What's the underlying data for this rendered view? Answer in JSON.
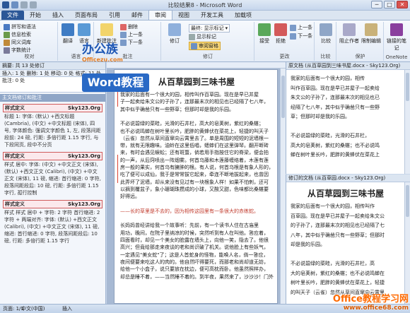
{
  "titlebar": {
    "title": "比较结果8 - Microsoft Word",
    "minimize": "─",
    "maximize": "□",
    "close": "✕"
  },
  "tabs": [
    "文件",
    "开始",
    "插入",
    "页面布局",
    "引用",
    "邮件",
    "审阅",
    "视图",
    "开发工具",
    "加载项"
  ],
  "active_tab": "审阅",
  "ribbon": {
    "proofing": {
      "label": "校对",
      "items": [
        "拼写和语法",
        "信息检索",
        "同义词库",
        "字数统计"
      ],
      "big": [
        "拼写和语法"
      ]
    },
    "language": {
      "label": "语言",
      "translate": "翻译",
      "language": "语言"
    },
    "comments": {
      "label": "批注",
      "new": "新建批注",
      "items": [
        "删除",
        "上一条",
        "下一条"
      ]
    },
    "tracking": {
      "label": "修订",
      "track": "修订",
      "items": [
        "最终: 显示标记",
        "显示标记",
        "审阅窗格"
      ]
    },
    "changes": {
      "label": "更改",
      "accept": "接受",
      "reject": "拒绝",
      "prev": "上一条",
      "next": "下一条"
    },
    "compare": {
      "label": "比较",
      "compare": "比较"
    },
    "protect": {
      "label": "保护",
      "block": "阻止作者",
      "restrict": "限制编辑"
    },
    "onenote": {
      "label": "OneNote",
      "linked": "链接的笔记"
    }
  },
  "navpane": {
    "header": "摘要: 共 13 处修订",
    "summary": "插入: 1 处  删除: 1 处  移动: 0 处  格式: 11 处  批注: 0 处",
    "tree_label": "主文档修订和批注",
    "styles": [
      {
        "name": "样式定义",
        "site": "Sky123.Org",
        "desc": "标题 1: 字体: (默认) +西文标题 (Cambria), (中文) +中文标题 (宋体), 四号, 字体颜色: 强调文字颜色 1, 左, 段落间距段前: 24 磅, 行距: 多倍行距 1.15 字行, 与下段同页, 段中不分页"
      },
      {
        "name": "样式定义",
        "site": "Sky123.Org",
        "desc": "样式 居中: 字体: (中文) +中文正文 (宋体), (默认) +西文正文 (Calibri), (中文) +中文正文 (宋体), 11 磅, 缩进: 首行缩进: 0 字符, 段落间距段后: 10 磅, 行距: 多倍行距 1.15 字行, 孤行控制"
      },
      {
        "name": "样式定义",
        "site": "Sky123.Org",
        "desc": "样式 样式 居中 + 字符: 2 字符 首行缩进: 2 字符 + 两端对齐: 字体: (默认) +西文正文 (Calibri), (中文) +中文正文 (宋体), 11 磅, 缩进: 首行缩进: 0 字符, 段落间距段后: 10 磅, 行距: 多倍行距 1.15 字行"
      }
    ]
  },
  "document": {
    "title": "从百草园到三味书屋",
    "paragraphs": [
      "我家的后面有一个很大的园，相传叫作百草园。现在是早已并屋",
      "子一起卖给朱文公的子孙了，连那最末次的相见也已经隔了七八年，",
      "其中似乎确凿只有一些野草；但那时却是我的乐园。",
      "",
      "不必说碧绿的菜畦，光滑的石井栏，高大的皂荚树，紫红的桑椹；",
      "也不必说鸣蝉在树叶里长吟，肥胖的黄蜂伏在菜花上，轻捷的叫天子",
      "（云雀）忽然从草间直窜向云霄里去了。单是周围的短短的泥墙根一",
      "带，就有无限趣味。油蛉在这里低唱，蟋蟀们在这里弹琴。翻开断砖",
      "来，有时会遇见蜈蚣；还有斑蝥，倘若用手指按住它的脊梁，便会拍",
      "的一声，从后窍喷出一阵烟雾。何首乌藤和木莲藤缠络着，木莲有莲",
      "房一般的果实，何首乌有臃肿的根。有人说，何首乌根是有象人形的，",
      "吃了便可以成仙，我于是常常拔它起来，牵连不断地拔起来，也曾因",
      "此弄坏了泥墙，却从来没有见过有一块根象人样！如果不怕刺，还可",
      "以摘到覆盆子，象小珊瑚珠攒成的小球，又酸又甜，色味都比桑椹要",
      "好得远。",
      "",
      "——长的草里是不去的，因为相传这园里有一条很大的赤练蛇。",
      "",
      "长妈妈曾经讲给我一个故事听：先前，有一个读书人住在古庙里",
      "用功，晚间，在院子里纳凉的时候，突然听到有人在叫他。答应着，",
      "四面看时，却见一个美女的脸露在墙头上，向他一笑，隐去了。他很",
      "高兴；但竟给那走来夜谈的老和尚识破了机关。说他脸上有些妖气，",
      "一定遇见\"美女蛇\"了；这是人首蛇身的怪物，能唤人名，倘一答应，",
      "夜间便要来吃这人的肉的。他自然吓得要死，而那老和尚却道无妨，",
      "给他一个小盒子，说只要放在枕边，便可高枕而卧。他虽然照样办，",
      "却总是睡不着，——当然睡不着的。到半夜，果然来了，沙沙沙！门外"
    ]
  },
  "orig_pane": {
    "header": "原文档 (从百草园到三味书屋.docx - Sky123.Org)",
    "lines": [
      "我家的后面有一个很大的园，相传",
      "叫作百草园。现在是早已并屋子一起卖给",
      "朱文公的子孙了，连那最末次的相见也已",
      "经隔了七八年，其中似乎确凿只有一些野",
      "草；但那时却是我的乐园。",
      "",
      "不必说碧绿的菜畦，光滑的石井栏，",
      "高大的皂荚树，紫红的桑椹；也不必说鸣",
      "蝉在树叶里长吟，肥胖的黄蜂伏在菜花上"
    ]
  },
  "rev_pane": {
    "header": "修订的文档 (从百草园.docx - Sky123.Org)",
    "title": "从百草园到三味书屋",
    "lines": [
      "我家的后面有一个很大的园，相传叫作",
      "百草园。现在是早已并屋子一起卖给朱文公",
      "的子孙了，连那最末次的相见也已经隔了七",
      "八年，其中似乎确凿只有一些野草；但那时",
      "却是我的乐园。",
      "",
      "不必说碧绿的菜畦，光滑的石井栏，高",
      "大的皂荚树，紫红的桑椹；也不必说鸣蝉在",
      "树叶里长吟，肥胖的黄蜂伏在菜花上，轻捷",
      "的叫天子（云雀）忽然从草间直窜向云霄里"
    ]
  },
  "status": {
    "page": "页面: 1/1",
    "words": "字数: 1,234",
    "lang": "中文(中国)",
    "mode": "插入",
    "zoom": "100%"
  },
  "watermarks": {
    "logo": "办公族",
    "logo_sub": "Officezu.com",
    "word": "Word教程",
    "footer": "Office教程学习网",
    "footer_url": "www.office68.com"
  }
}
